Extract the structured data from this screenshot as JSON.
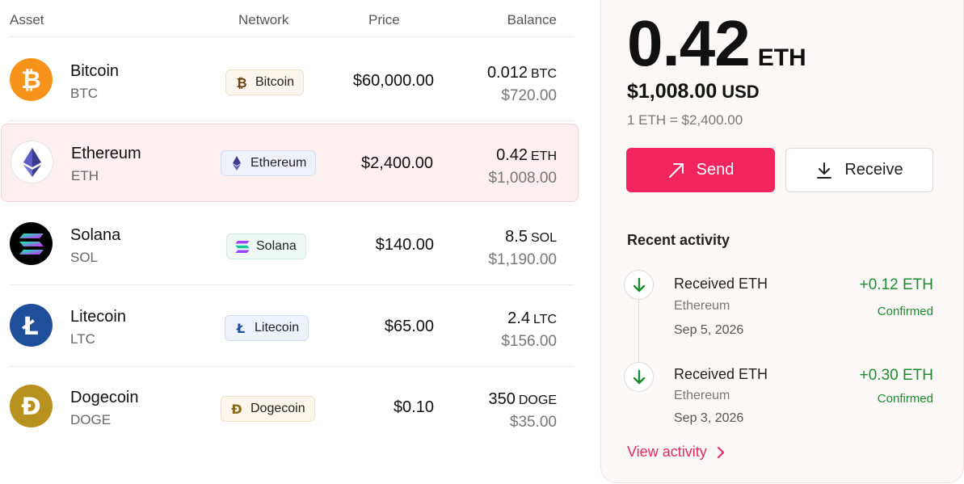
{
  "table": {
    "headers": {
      "asset": "Asset",
      "network": "Network",
      "price": "Price",
      "balance": "Balance"
    },
    "rows": [
      {
        "name": "Bitcoin",
        "symbol": "BTC",
        "network": "Bitcoin",
        "price": "$60,000.00",
        "balance_amount": "0.012",
        "balance_unit": "BTC",
        "balance_usd": "$720.00",
        "icon": "bitcoin-icon",
        "color": "#f7931a"
      },
      {
        "name": "Ethereum",
        "symbol": "ETH",
        "network": "Ethereum",
        "price": "$2,400.00",
        "balance_amount": "0.42",
        "balance_unit": "ETH",
        "balance_usd": "$1,008.00",
        "icon": "ethereum-icon",
        "color": "#627eea",
        "selected": true
      },
      {
        "name": "Solana",
        "symbol": "SOL",
        "network": "Solana",
        "price": "$140.00",
        "balance_amount": "8.5",
        "balance_unit": "SOL",
        "balance_usd": "$1,190.00",
        "icon": "solana-icon",
        "color": "#000000"
      },
      {
        "name": "Litecoin",
        "symbol": "LTC",
        "network": "Litecoin",
        "price": "$65.00",
        "balance_amount": "2.4",
        "balance_unit": "LTC",
        "balance_usd": "$156.00",
        "icon": "litecoin-icon",
        "color": "#1f4f9a"
      },
      {
        "name": "Dogecoin",
        "symbol": "DOGE",
        "network": "Dogecoin",
        "price": "$0.10",
        "balance_amount": "350",
        "balance_unit": "DOGE",
        "balance_usd": "$35.00",
        "icon": "dogecoin-icon",
        "color": "#b8911f"
      }
    ]
  },
  "detail": {
    "amount": "0.42",
    "unit": "ETH",
    "usd_value": "$1,008.00",
    "usd_unit": "USD",
    "rate": "1 ETH = $2,400.00",
    "send_label": "Send",
    "receive_label": "Receive",
    "accent": "#f2245d"
  },
  "activity": {
    "title": "Recent activity",
    "items": [
      {
        "title": "Received ETH",
        "network": "Ethereum",
        "date": "Sep 5, 2026",
        "amount": "+0.12 ETH",
        "status": "Confirmed"
      },
      {
        "title": "Received ETH",
        "network": "Ethereum",
        "date": "Sep 3, 2026",
        "amount": "+0.30 ETH",
        "status": "Confirmed"
      }
    ],
    "view_label": "View activity"
  }
}
